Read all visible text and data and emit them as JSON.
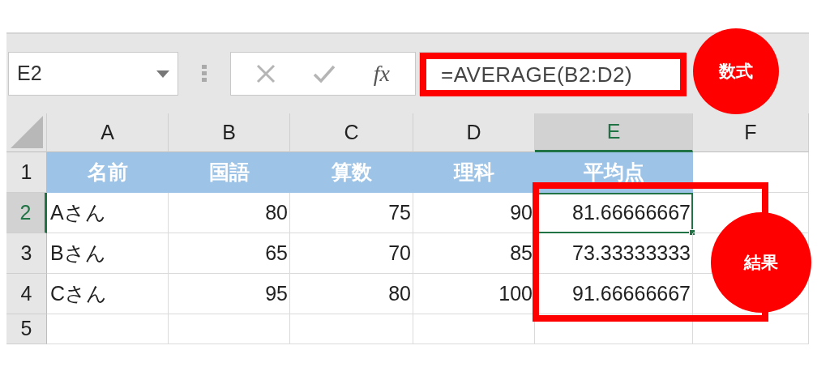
{
  "name_box": {
    "value": "E2"
  },
  "formula_bar": {
    "function_label": "fx",
    "value": "=AVERAGE(B2:D2)"
  },
  "columns": [
    {
      "label": "A",
      "selected": false
    },
    {
      "label": "B",
      "selected": false
    },
    {
      "label": "C",
      "selected": false
    },
    {
      "label": "D",
      "selected": false
    },
    {
      "label": "E",
      "selected": true
    },
    {
      "label": "F",
      "selected": false
    }
  ],
  "rows": [
    {
      "label": "1",
      "selected": false,
      "cells": [
        {
          "text": "名前",
          "kind": "header"
        },
        {
          "text": "国語",
          "kind": "header"
        },
        {
          "text": "算数",
          "kind": "header"
        },
        {
          "text": "理科",
          "kind": "header"
        },
        {
          "text": "平均点",
          "kind": "header"
        }
      ]
    },
    {
      "label": "2",
      "selected": true,
      "cells": [
        {
          "text": "Aさん",
          "kind": "text"
        },
        {
          "text": "80",
          "kind": "number"
        },
        {
          "text": "75",
          "kind": "number"
        },
        {
          "text": "90",
          "kind": "number"
        },
        {
          "text": "81.66666667",
          "kind": "number"
        }
      ]
    },
    {
      "label": "3",
      "selected": false,
      "cells": [
        {
          "text": "Bさん",
          "kind": "text"
        },
        {
          "text": "65",
          "kind": "number"
        },
        {
          "text": "70",
          "kind": "number"
        },
        {
          "text": "85",
          "kind": "number"
        },
        {
          "text": "73.33333333",
          "kind": "number"
        }
      ]
    },
    {
      "label": "4",
      "selected": false,
      "cells": [
        {
          "text": "Cさん",
          "kind": "text"
        },
        {
          "text": "95",
          "kind": "number"
        },
        {
          "text": "80",
          "kind": "number"
        },
        {
          "text": "100",
          "kind": "number"
        },
        {
          "text": "91.66666667",
          "kind": "number"
        }
      ]
    },
    {
      "label": "5",
      "selected": false,
      "cells": []
    }
  ],
  "annotations": [
    {
      "text": "数式",
      "kind": "formula"
    },
    {
      "text": "結果",
      "kind": "result"
    }
  ]
}
